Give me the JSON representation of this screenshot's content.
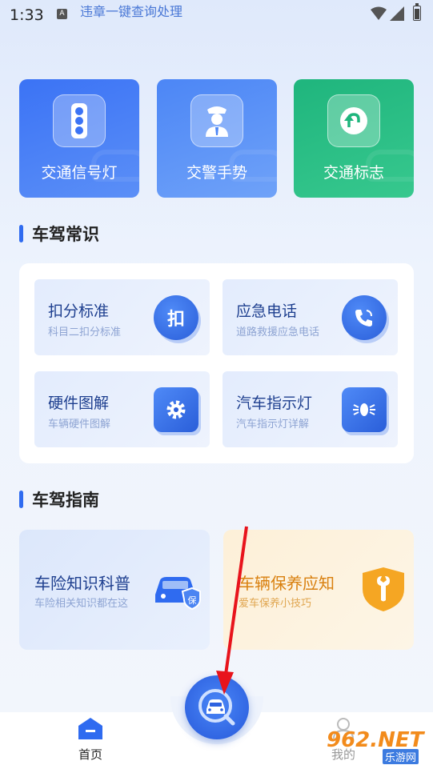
{
  "status_bar": {
    "time": "1:33",
    "notification_icon": "A",
    "title": "违章一键查询处理"
  },
  "tiles": [
    {
      "label": "交通信号灯",
      "icon": "traffic-light-icon"
    },
    {
      "label": "交警手势",
      "icon": "police-icon"
    },
    {
      "label": "交通标志",
      "icon": "u-turn-sign-icon"
    }
  ],
  "sections": {
    "knowledge": "车驾常识",
    "guide": "车驾指南"
  },
  "knowledge_items": [
    {
      "title": "扣分标准",
      "subtitle": "科目二扣分标准",
      "icon_text": "扣",
      "icon": "deduct-points-icon"
    },
    {
      "title": "应急电话",
      "subtitle": "道路救援应急电话",
      "icon": "phone-icon"
    },
    {
      "title": "硬件图解",
      "subtitle": "车辆硬件图解",
      "icon": "gear-icon"
    },
    {
      "title": "汽车指示灯",
      "subtitle": "汽车指示灯详解",
      "icon": "indicator-light-icon"
    }
  ],
  "guides": [
    {
      "title": "车险知识科普",
      "subtitle": "车险相关知识都在这",
      "icon": "car-insurance-icon",
      "badge": "保"
    },
    {
      "title": "车辆保养应知",
      "subtitle": "爱车保养小技巧",
      "icon": "wrench-shield-icon"
    }
  ],
  "nav": {
    "home": "首页",
    "mine": "我的"
  },
  "watermark": {
    "main": "962.NET",
    "sub": "乐游网"
  },
  "colors": {
    "accent": "#2f6bf0",
    "green": "#1fb57d",
    "orange": "#d9800f"
  }
}
